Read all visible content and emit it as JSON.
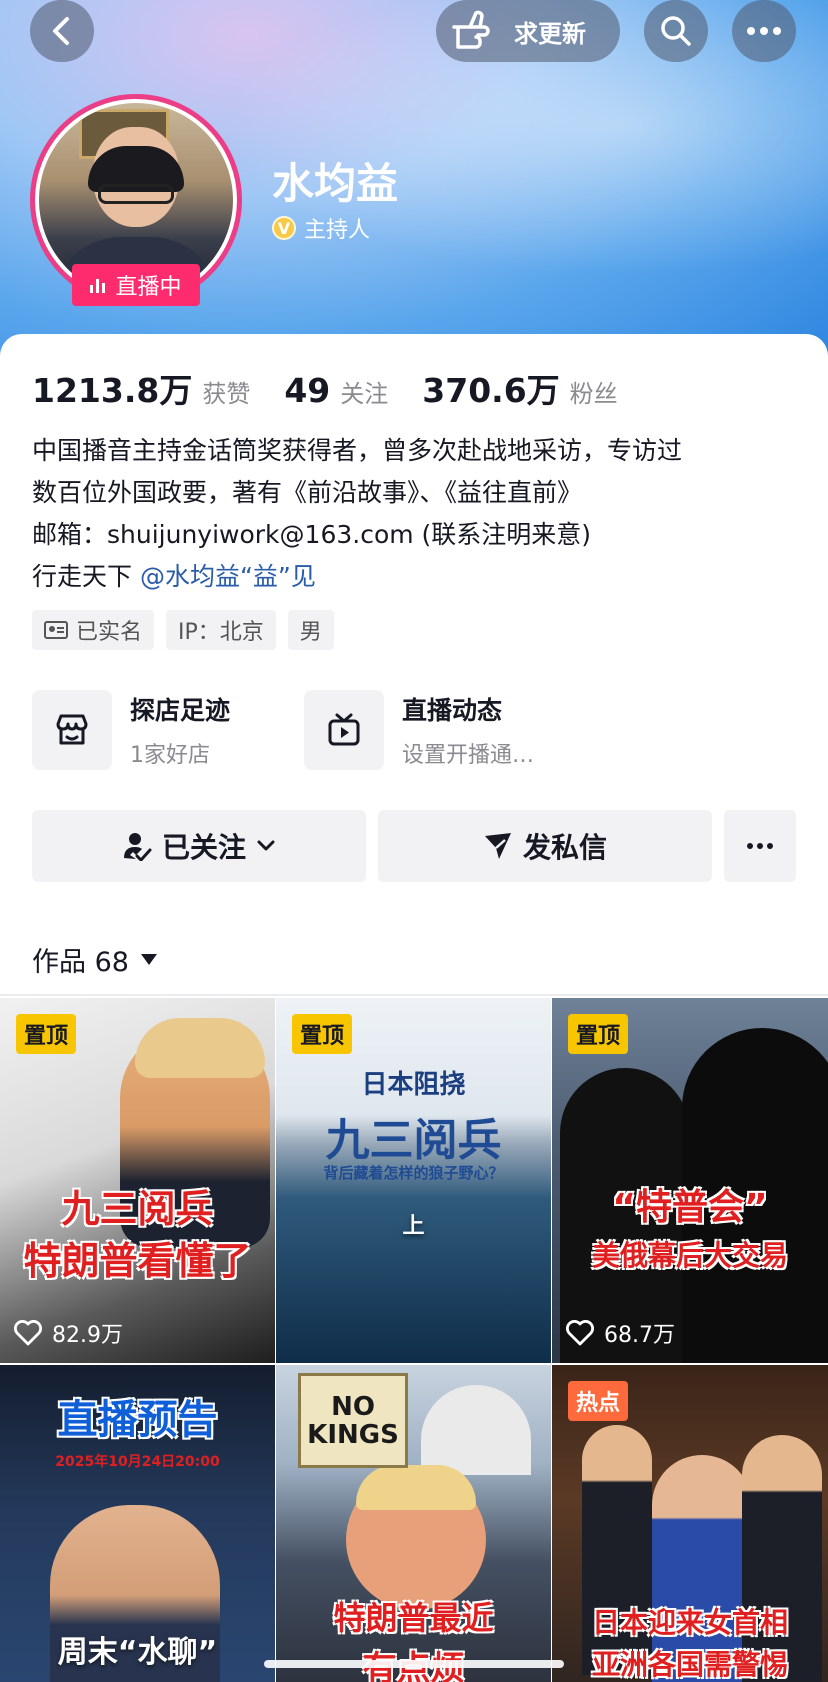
{
  "header": {
    "request_update_label": "求更新",
    "profile_name": "水均益",
    "verified_role": "主持人",
    "verified_icon_letter": "V",
    "live_badge_label": "直播中"
  },
  "stats": [
    {
      "value": "1213.8万",
      "label": "获赞"
    },
    {
      "value": "49",
      "label": "关注"
    },
    {
      "value": "370.6万",
      "label": "粉丝"
    }
  ],
  "bio": {
    "line1": "中国播音主持金话筒奖获得者，曾多次赴战地采访，专访过",
    "line2": "数百位外国政要，著有《前沿故事》、《益往直前》",
    "line3": "邮箱：shuijunyiwork@163.com (联系注明来意)",
    "line4_prefix": "行走天下 ",
    "line4_mention": "@水均益“益”见"
  },
  "tags": [
    "已实名",
    "IP：北京",
    "男"
  ],
  "shortcuts": [
    {
      "title": "探店足迹",
      "subtitle": "1家好店"
    },
    {
      "title": "直播动态",
      "subtitle": "设置开播通…"
    }
  ],
  "actions": {
    "follow_label": "已关注",
    "message_label": "发私信"
  },
  "works": {
    "label": "作品 68",
    "items": [
      {
        "badge": "置顶",
        "caption1": "九三阅兵",
        "caption2": "特朗普看懂了",
        "likes": "82.9万"
      },
      {
        "badge": "置顶",
        "caption_top": "日本阻挠",
        "caption1": "九三阅兵",
        "caption_sub": "背后藏着怎样的狼子野心？",
        "caption_mark": "上"
      },
      {
        "badge": "置顶",
        "caption1": "“特普会”",
        "caption2": "美俄幕后大交易",
        "likes": "68.7万"
      },
      {
        "caption1": "直播预告",
        "caption_sub": "2025年10月24日20:00",
        "caption2": "周末“水聊”"
      },
      {
        "sign_text": "NO KINGS",
        "caption1": "特朗普最近",
        "caption2": "有点烦"
      },
      {
        "badge": "热点",
        "caption1": "日本迎来女首相",
        "caption2": "亚洲各国需警惕"
      }
    ]
  },
  "icons": {
    "back": "chevron-left-icon",
    "search": "search-icon",
    "more": "more-dots-icon",
    "hand": "pointing-hand-icon"
  }
}
